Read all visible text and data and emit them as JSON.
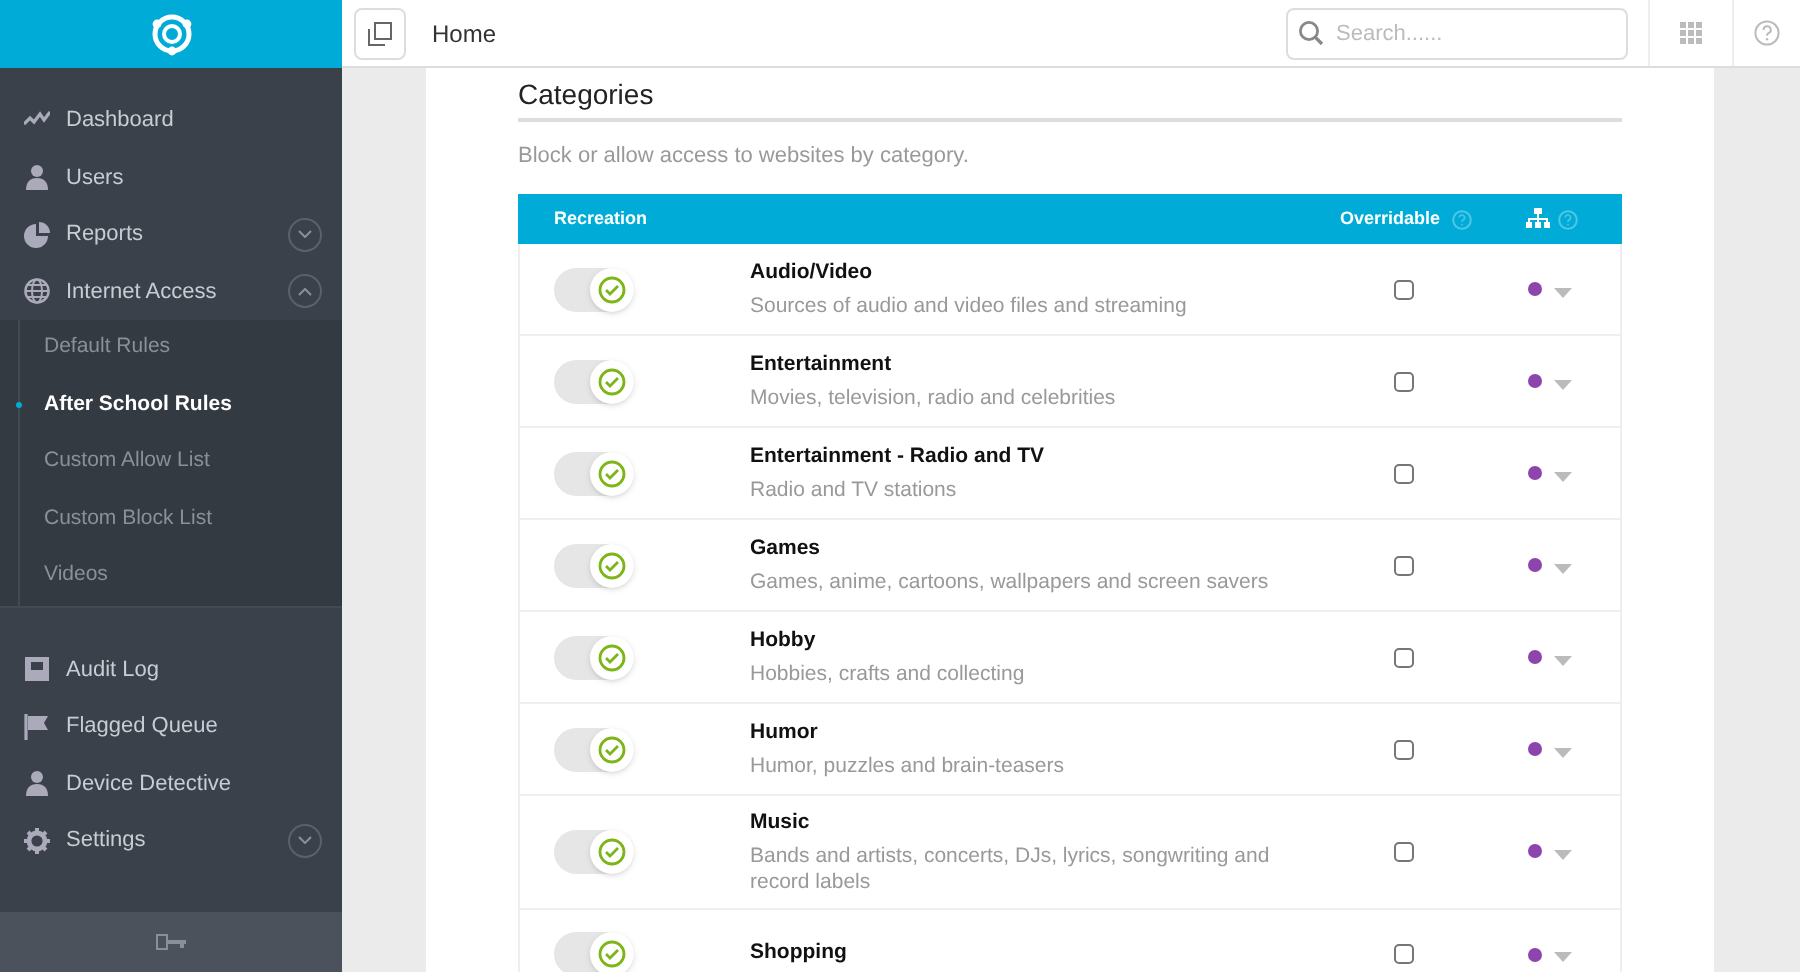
{
  "topbar": {
    "breadcrumb": "Home",
    "search": {
      "placeholder": "Search......"
    }
  },
  "sidebar": {
    "items": [
      {
        "label": "Dashboard",
        "selected": false
      },
      {
        "label": "Users",
        "selected": false
      },
      {
        "label": "Reports",
        "selected": false,
        "expanded": false
      },
      {
        "label": "Internet Access",
        "selected": false,
        "expanded": true,
        "children": [
          {
            "label": "Default Rules",
            "selected": false
          },
          {
            "label": "After School Rules",
            "selected": true
          },
          {
            "label": "Custom Allow List",
            "selected": false
          },
          {
            "label": "Custom Block List",
            "selected": false
          },
          {
            "label": "Videos",
            "selected": false
          }
        ]
      },
      {
        "label": "Audit Log",
        "selected": false
      },
      {
        "label": "Flagged Queue",
        "selected": false
      },
      {
        "label": "Device Detective",
        "selected": false
      },
      {
        "label": "Settings",
        "selected": false,
        "expanded": false
      }
    ]
  },
  "section": {
    "title": "Categories",
    "description": "Block or allow access to websites by category."
  },
  "table": {
    "group": "Recreation",
    "overridable_header": "Overridable",
    "rows": [
      {
        "name": "Audio/Video",
        "description": "Sources of audio and video files and streaming",
        "on": true,
        "overridable": false
      },
      {
        "name": "Entertainment",
        "description": "Movies, television, radio and celebrities",
        "on": true,
        "overridable": false
      },
      {
        "name": "Entertainment - Radio and TV",
        "description": "Radio and TV stations",
        "on": true,
        "overridable": false
      },
      {
        "name": "Games",
        "description": "Games, anime, cartoons, wallpapers and screen savers",
        "on": true,
        "overridable": false
      },
      {
        "name": "Hobby",
        "description": "Hobbies, crafts and collecting",
        "on": true,
        "overridable": false
      },
      {
        "name": "Humor",
        "description": "Humor, puzzles and brain-teasers",
        "on": true,
        "overridable": false
      },
      {
        "name": "Music",
        "description": "Bands and artists, concerts, DJs, lyrics, songwriting and record labels",
        "on": true,
        "overridable": false
      },
      {
        "name": "Shopping",
        "on": true,
        "overridable": false
      }
    ]
  }
}
